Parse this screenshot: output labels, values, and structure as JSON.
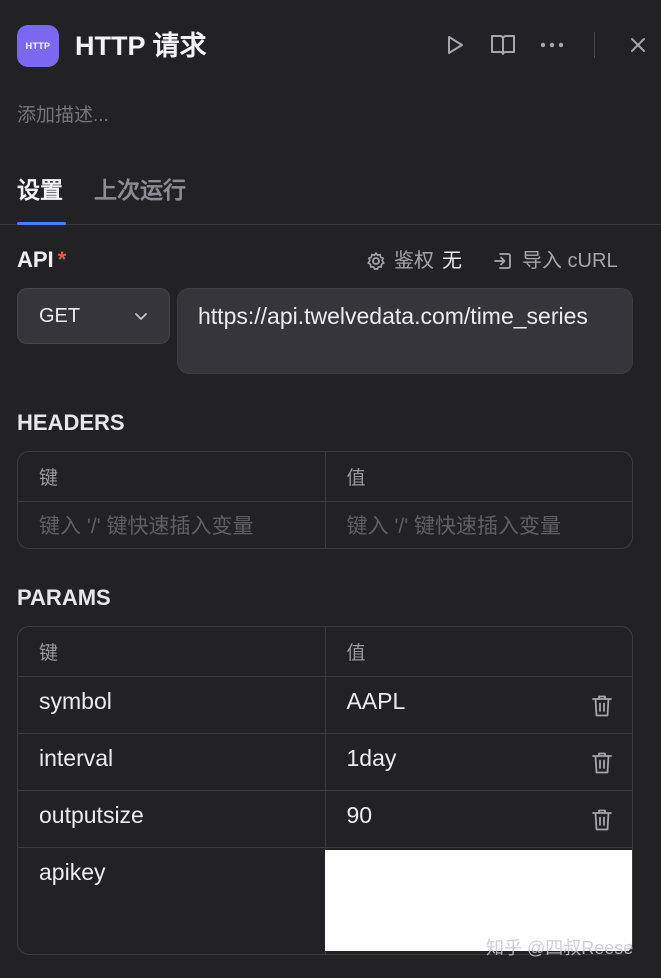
{
  "header": {
    "icon_label": "HTTP",
    "title": "HTTP 请求",
    "icons": [
      "play-icon",
      "book-open-icon",
      "more-icon",
      "close-icon"
    ]
  },
  "description_placeholder": "添加描述...",
  "tabs": [
    {
      "label": "设置",
      "active": true
    },
    {
      "label": "上次运行",
      "active": false
    }
  ],
  "api": {
    "label": "API",
    "required_mark": "*",
    "auth_label": "鉴权",
    "auth_value": "无",
    "import_curl_label": "导入 cURL",
    "method": "GET",
    "url": "https://api.twelvedata.com/time_series"
  },
  "headers_section": {
    "label": "HEADERS",
    "key_col": "键",
    "value_col": "值",
    "key_placeholder": "键入 '/' 键快速插入变量",
    "value_placeholder": "键入 '/' 键快速插入变量"
  },
  "params_section": {
    "label": "PARAMS",
    "key_col": "键",
    "value_col": "值",
    "rows": [
      {
        "key": "symbol",
        "value": "AAPL"
      },
      {
        "key": "interval",
        "value": "1day"
      },
      {
        "key": "outputsize",
        "value": "90"
      },
      {
        "key": "apikey",
        "value": ""
      }
    ]
  },
  "watermark": "知乎 @四叔Reese",
  "colors": {
    "background": "#222225",
    "accent": "#4f7cf7",
    "node_icon": "#7a68f2",
    "required": "#f2574b"
  }
}
